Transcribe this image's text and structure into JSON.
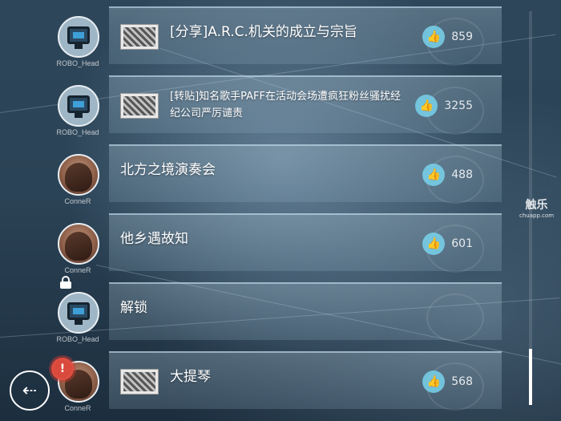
{
  "posts": [
    {
      "author": "ROBO_Head",
      "avatar": "robo",
      "title": "[分享]A.R.C.机关的成立与宗旨",
      "likes": "859",
      "has_thumb": true,
      "small": false,
      "locked": false,
      "alert": false
    },
    {
      "author": "ROBO_Head",
      "avatar": "robo",
      "title": "[转贴]知名歌手PAFF在活动会场遭疯狂粉丝骚扰经纪公司严厉谴责",
      "likes": "3255",
      "has_thumb": true,
      "small": true,
      "locked": false,
      "alert": false
    },
    {
      "author": "ConneR",
      "avatar": "conner",
      "title": "北方之境演奏会",
      "likes": "488",
      "has_thumb": false,
      "small": false,
      "locked": false,
      "alert": false
    },
    {
      "author": "ConneR",
      "avatar": "conner",
      "title": "他乡遇故知",
      "likes": "601",
      "has_thumb": false,
      "small": false,
      "locked": false,
      "alert": false
    },
    {
      "author": "ROBO_Head",
      "avatar": "robo",
      "title": "解锁",
      "likes": "",
      "has_thumb": false,
      "small": false,
      "locked": true,
      "alert": false
    },
    {
      "author": "ConneR",
      "avatar": "conner",
      "title": "大提琴",
      "likes": "568",
      "has_thumb": true,
      "small": false,
      "locked": false,
      "alert": true
    }
  ],
  "alert_mark": "!",
  "back_icon": "back-arrow-icon",
  "back_glyph": "⇠",
  "like_glyph": "👍",
  "watermark": {
    "main": "触乐",
    "sub": "chuapp.com"
  },
  "scroll_position": 0.92
}
